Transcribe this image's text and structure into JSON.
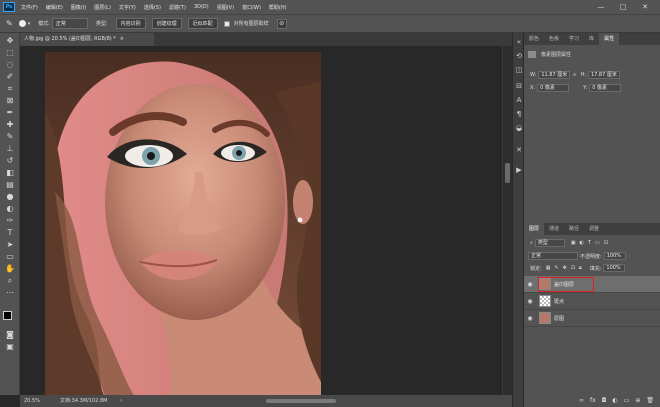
{
  "menu": {
    "logo": "Ps",
    "items": [
      "文件(F)",
      "编辑(E)",
      "图像(I)",
      "图层(L)",
      "文字(Y)",
      "选择(S)",
      "滤镜(T)",
      "3D(D)",
      "视图(V)",
      "窗口(W)",
      "帮助(H)"
    ],
    "window_controls": [
      "—",
      "□",
      "✕"
    ]
  },
  "options": {
    "mode_label": "模式:",
    "mode_value": "正常",
    "type_label": "类型:",
    "btn_content": "内容识别",
    "btn_texture": "创建纹理",
    "btn_proximity": "近似匹配",
    "sample_all_label": "对所有图层取样"
  },
  "document": {
    "tab_title": "人物.jpg @ 20.5% (盖印图层, RGB/8) *",
    "zoom": "20.5%",
    "doc_size": "文档:34.3M/102.8M"
  },
  "properties_panel": {
    "tabs": [
      "颜色",
      "色板",
      "学习",
      "库",
      "属性"
    ],
    "active_tab": "属性",
    "header": "像素图层属性",
    "w_label": "W:",
    "w_value": "11.87 厘米",
    "h_label": "H:",
    "h_value": "17.87 厘米",
    "x_label": "X:",
    "x_value": "0 像素",
    "y_label": "Y:",
    "y_value": "0 像素"
  },
  "layers_panel": {
    "tabs": [
      "图层",
      "通道",
      "路径",
      "调整"
    ],
    "active_tab": "图层",
    "filter_label": "类型",
    "blend_mode": "正常",
    "opacity_label": "不透明度:",
    "opacity_value": "100%",
    "lock_label": "锁定:",
    "fill_label": "填充:",
    "fill_value": "100%",
    "layers": [
      {
        "name": "盖印图层",
        "selected": true
      },
      {
        "name": "斑点",
        "selected": false
      },
      {
        "name": "原图",
        "selected": false
      }
    ],
    "highlight_color": "#e02020"
  },
  "colors": {
    "foreground": "#000000",
    "background": "#ffffff",
    "accent": "#31a8ff"
  }
}
